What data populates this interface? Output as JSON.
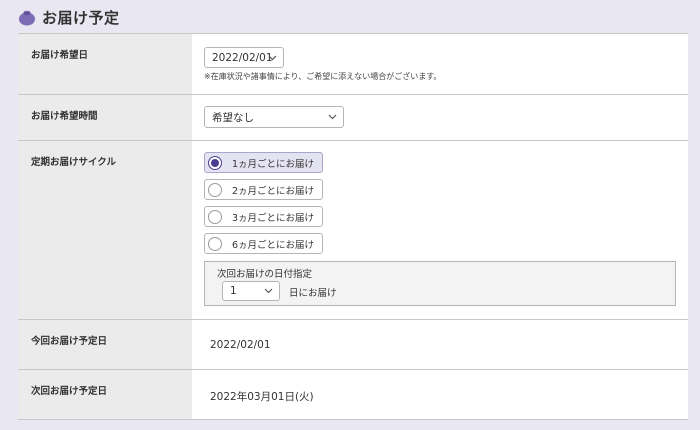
{
  "header": {
    "title": "お届け予定"
  },
  "rows": {
    "delivery_date": {
      "label": "お届け希望日",
      "selected": "2022/02/01",
      "note": "※在庫状況や諸事情により、ご希望に添えない場合がございます。"
    },
    "delivery_time": {
      "label": "お届け希望時間",
      "selected": "希望なし"
    },
    "cycle": {
      "label": "定期お届けサイクル",
      "options": [
        {
          "label": "1ヵ月ごとにお届け",
          "selected": true
        },
        {
          "label": "2ヵ月ごとにお届け",
          "selected": false
        },
        {
          "label": "3ヵ月ごとにお届け",
          "selected": false
        },
        {
          "label": "6ヵ月ごとにお届け",
          "selected": false
        }
      ],
      "next_day": {
        "title": "次回お届けの日付指定",
        "selected": "1",
        "suffix": "日にお届け"
      }
    },
    "this_date": {
      "label": "今回お届け予定日",
      "value": "2022/02/01"
    },
    "next_date": {
      "label": "次回お届け予定日",
      "value": "2022年03月01日(火)"
    }
  },
  "colors": {
    "accent": "#4a3f8f",
    "icon": "#7b6bb4",
    "page_bg": "#e9e8f2",
    "label_bg": "#ebebeb"
  }
}
